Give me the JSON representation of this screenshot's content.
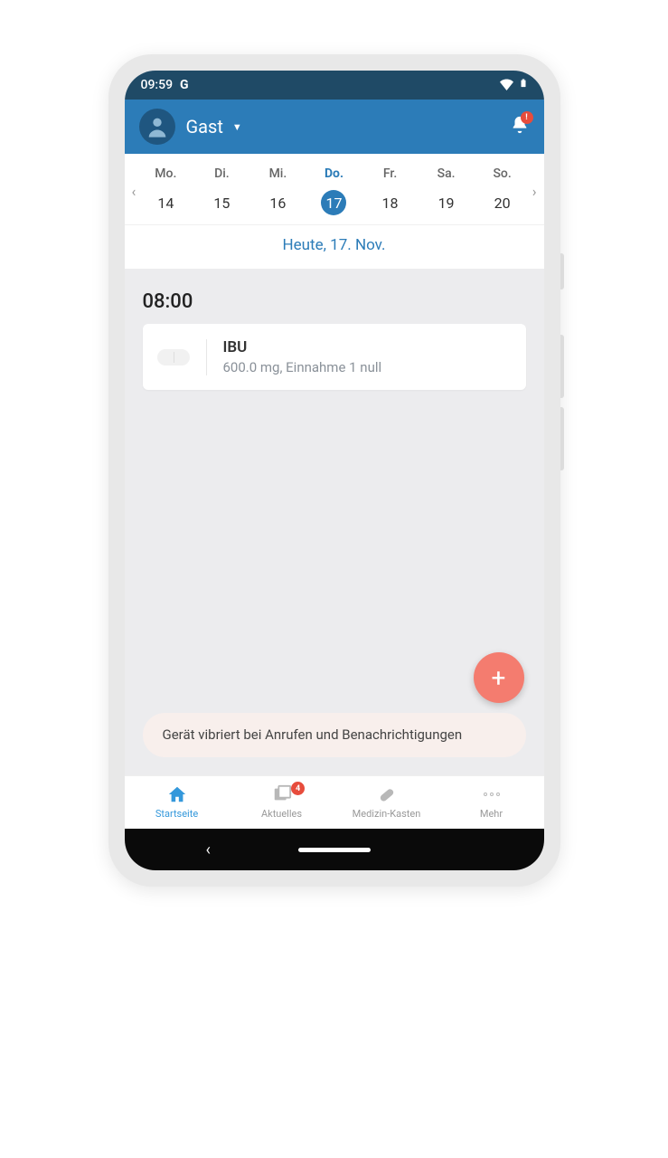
{
  "status": {
    "time": "09:59",
    "indicator": "G"
  },
  "header": {
    "profile_name": "Gast",
    "notification_badge": "!"
  },
  "week": {
    "days": [
      {
        "label": "Mo.",
        "num": "14",
        "selected": false
      },
      {
        "label": "Di.",
        "num": "15",
        "selected": false
      },
      {
        "label": "Mi.",
        "num": "16",
        "selected": false
      },
      {
        "label": "Do.",
        "num": "17",
        "selected": true
      },
      {
        "label": "Fr.",
        "num": "18",
        "selected": false
      },
      {
        "label": "Sa.",
        "num": "19",
        "selected": false
      },
      {
        "label": "So.",
        "num": "20",
        "selected": false
      }
    ],
    "today_text": "Heute, 17. Nov."
  },
  "schedule": {
    "time": "08:00",
    "med": {
      "name": "IBU",
      "detail": "600.0 mg, Einnahme 1 null"
    }
  },
  "toast": "Gerät vibriert bei Anrufen und Benachrichtigungen",
  "fab": {
    "glyph": "+"
  },
  "nav": {
    "items": [
      {
        "label": "Startseite",
        "active": true
      },
      {
        "label": "Aktuelles",
        "badge": "4"
      },
      {
        "label": "Medizin-Kasten"
      },
      {
        "label": "Mehr"
      }
    ]
  }
}
